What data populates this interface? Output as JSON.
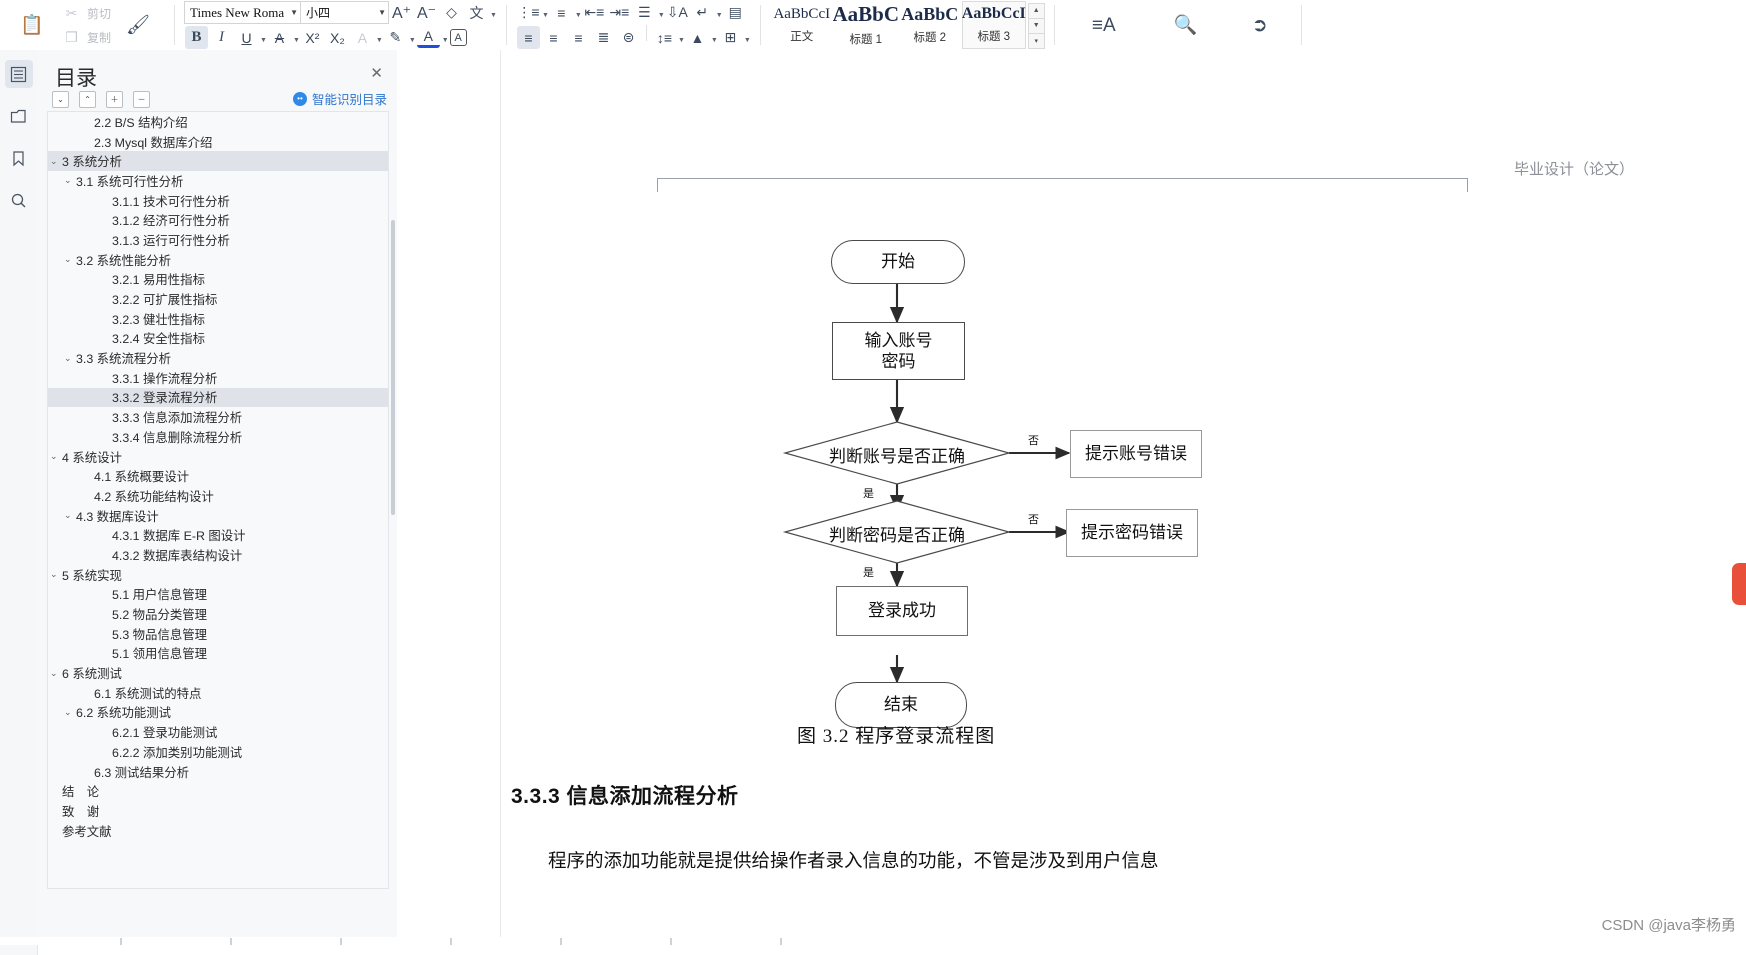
{
  "toolbar": {
    "paste_label": "粘贴",
    "cut_label": "剪切",
    "copy_label": "复制",
    "format_painter_label": "格式刷",
    "font_name": "Times New Roma",
    "font_size": "小四",
    "grow_font": "A",
    "shrink_font": "A",
    "clear_format_icon": "eraser-icon",
    "pinyin_icon": "pinyin-guide-icon",
    "bold": "B",
    "italic": "I",
    "underline": "U",
    "strikethrough": "A",
    "superscript": "X²",
    "subscript": "X₂",
    "char_border": "A",
    "highlight": "A",
    "font_color": "A",
    "char_shade": "A",
    "bullets_icon": "bullet-list-icon",
    "numbering_icon": "numbered-list-icon",
    "decrease_indent_icon": "decrease-indent-icon",
    "increase_indent_icon": "increase-indent-icon",
    "multilevel_icon": "multilevel-list-icon",
    "sort_icon": "sort-icon",
    "show_marks_icon": "paragraph-marks-icon",
    "ruler_icon": "ruler-icon",
    "align_left_icon": "align-left-icon",
    "align_center_icon": "align-center-icon",
    "align_right_icon": "align-right-icon",
    "align_justify_icon": "align-justify-icon",
    "distribute_icon": "distribute-icon",
    "line_spacing_icon": "line-spacing-icon",
    "shading_icon": "shading-icon",
    "borders_icon": "borders-icon",
    "styles": [
      {
        "sample": "AaBbCcI",
        "name": "正文",
        "size": 15,
        "bold": false
      },
      {
        "sample": "AaBbC",
        "name": "标题 1",
        "size": 21,
        "bold": true
      },
      {
        "sample": "AaBbC",
        "name": "标题 2",
        "size": 18,
        "bold": true
      },
      {
        "sample": "AaBbCcI",
        "name": "标题 3",
        "size": 16,
        "bold": true
      }
    ],
    "selected_style": "标题 3",
    "text_layout_label": "文字排版",
    "find_replace_label": "查找替换",
    "select_label": "选择"
  },
  "rail": {
    "items": [
      {
        "name": "outline-icon",
        "active": true
      },
      {
        "name": "thumbnail-icon",
        "active": false
      },
      {
        "name": "bookmark-icon",
        "active": false
      },
      {
        "name": "search-icon",
        "active": false
      }
    ]
  },
  "toc": {
    "title": "目录",
    "close_label": "✕",
    "tools": [
      {
        "name": "expand-all-icon",
        "glyph": "⌄"
      },
      {
        "name": "collapse-all-icon",
        "glyph": "⌃"
      },
      {
        "name": "expand-level-icon",
        "glyph": "＋"
      },
      {
        "name": "collapse-level-icon",
        "glyph": "－"
      }
    ],
    "ai_label": "智能识别目录",
    "items": [
      {
        "label": "2.2 B/S 结构介绍",
        "indent": 3,
        "chev": "",
        "sel": false
      },
      {
        "label": "2.3 Mysql 数据库介绍",
        "indent": 3,
        "chev": "",
        "sel": false
      },
      {
        "label": "3  系统分析",
        "indent": 1,
        "chev": "⌄",
        "sel": true
      },
      {
        "label": "3.1  系统可行性分析",
        "indent": 2,
        "chev": "⌄",
        "sel": false
      },
      {
        "label": "3.1.1 技术可行性分析",
        "indent": 4,
        "chev": "",
        "sel": false
      },
      {
        "label": "3.1.2 经济可行性分析",
        "indent": 4,
        "chev": "",
        "sel": false
      },
      {
        "label": "3.1.3 运行可行性分析",
        "indent": 4,
        "chev": "",
        "sel": false
      },
      {
        "label": "3.2  系统性能分析",
        "indent": 2,
        "chev": "⌄",
        "sel": false
      },
      {
        "label": "3.2.1 易用性指标",
        "indent": 4,
        "chev": "",
        "sel": false
      },
      {
        "label": "3.2.2 可扩展性指标",
        "indent": 4,
        "chev": "",
        "sel": false
      },
      {
        "label": "3.2.3 健壮性指标",
        "indent": 4,
        "chev": "",
        "sel": false
      },
      {
        "label": "3.2.4 安全性指标",
        "indent": 4,
        "chev": "",
        "sel": false
      },
      {
        "label": "3.3  系统流程分析",
        "indent": 2,
        "chev": "⌄",
        "sel": false
      },
      {
        "label": "3.3.1 操作流程分析",
        "indent": 4,
        "chev": "",
        "sel": false
      },
      {
        "label": "3.3.2 登录流程分析",
        "indent": 4,
        "chev": "",
        "sel": true
      },
      {
        "label": "3.3.3 信息添加流程分析",
        "indent": 4,
        "chev": "",
        "sel": false
      },
      {
        "label": "3.3.4 信息删除流程分析",
        "indent": 4,
        "chev": "",
        "sel": false
      },
      {
        "label": "4  系统设计",
        "indent": 1,
        "chev": "⌄",
        "sel": false
      },
      {
        "label": "4.1  系统概要设计",
        "indent": 3,
        "chev": "",
        "sel": false
      },
      {
        "label": "4.2  系统功能结构设计",
        "indent": 3,
        "chev": "",
        "sel": false
      },
      {
        "label": "4.3  数据库设计",
        "indent": 2,
        "chev": "⌄",
        "sel": false
      },
      {
        "label": "4.3.1  数据库 E-R 图设计",
        "indent": 4,
        "chev": "",
        "sel": false
      },
      {
        "label": "4.3.2  数据库表结构设计",
        "indent": 4,
        "chev": "",
        "sel": false
      },
      {
        "label": "5  系统实现",
        "indent": 1,
        "chev": "⌄",
        "sel": false
      },
      {
        "label": "5.1 用户信息管理",
        "indent": 4,
        "chev": "",
        "sel": false
      },
      {
        "label": "5.2  物品分类管理",
        "indent": 4,
        "chev": "",
        "sel": false
      },
      {
        "label": "5.3 物品信息管理",
        "indent": 4,
        "chev": "",
        "sel": false
      },
      {
        "label": "5.1 领用信息管理",
        "indent": 4,
        "chev": "",
        "sel": false
      },
      {
        "label": "6  系统测试",
        "indent": 1,
        "chev": "⌄",
        "sel": false
      },
      {
        "label": "6.1  系统测试的特点",
        "indent": 3,
        "chev": "",
        "sel": false
      },
      {
        "label": "6.2  系统功能测试",
        "indent": 2,
        "chev": "⌄",
        "sel": false
      },
      {
        "label": "6.2.1  登录功能测试",
        "indent": 4,
        "chev": "",
        "sel": false
      },
      {
        "label": "6.2.2  添加类别功能测试",
        "indent": 4,
        "chev": "",
        "sel": false
      },
      {
        "label": "6.3  测试结果分析",
        "indent": 3,
        "chev": "",
        "sel": false
      },
      {
        "label": "结　论",
        "indent": 1,
        "chev": "",
        "sel": false
      },
      {
        "label": "致　谢",
        "indent": 1,
        "chev": "",
        "sel": false
      },
      {
        "label": "参考文献",
        "indent": 1,
        "chev": "",
        "sel": false
      }
    ]
  },
  "document": {
    "header_text": "毕业设计（论文）",
    "flowchart": {
      "start": "开始",
      "input": "输入账号\n密码",
      "input_line1": "输入账号",
      "input_line2": "密码",
      "decision_account": "判断账号是否正确",
      "error_account": "提示账号错误",
      "decision_password": "判断密码是否正确",
      "error_password": "提示密码错误",
      "success": "登录成功",
      "end": "结束",
      "label_no": "否",
      "label_yes": "是"
    },
    "figure_caption": "图 3.2  程序登录流程图",
    "heading": "3.3.3  信息添加流程分析",
    "paragraph": "程序的添加功能就是提供给操作者录入信息的功能，不管是涉及到用户信息",
    "watermark": "CSDN @java李杨勇"
  }
}
